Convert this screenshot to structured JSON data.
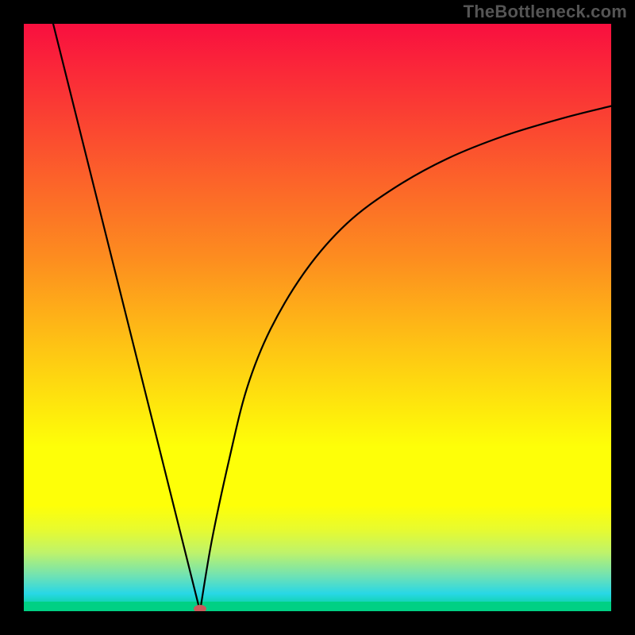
{
  "watermark": "TheBottleneck.com",
  "colors": {
    "frame": "#000000",
    "watermark": "#555555",
    "curve": "#000000",
    "marker": "#cc5a5a",
    "gradientStops": [
      {
        "offset": 0.0,
        "color": "#f90f3f"
      },
      {
        "offset": 0.2,
        "color": "#fb4e2f"
      },
      {
        "offset": 0.4,
        "color": "#fd8d1f"
      },
      {
        "offset": 0.55,
        "color": "#fec414"
      },
      {
        "offset": 0.72,
        "color": "#feff08"
      },
      {
        "offset": 0.82,
        "color": "#feff08"
      },
      {
        "offset": 0.86,
        "color": "#e8fb2e"
      },
      {
        "offset": 0.9,
        "color": "#bff36a"
      },
      {
        "offset": 0.94,
        "color": "#6fe2b4"
      },
      {
        "offset": 0.97,
        "color": "#28d7e6"
      },
      {
        "offset": 1.0,
        "color": "#00d084"
      }
    ],
    "finalGreen": "#00d084"
  },
  "chart_data": {
    "type": "line",
    "title": "",
    "xlabel": "",
    "ylabel": "",
    "xlim": [
      0,
      100
    ],
    "ylim": [
      0,
      100
    ],
    "grid": false,
    "x_min_at": 30,
    "marker": {
      "x": 30,
      "y": 0
    },
    "left_arm": {
      "x": [
        5,
        10,
        15,
        20,
        25,
        28,
        30
      ],
      "y": [
        100,
        80,
        60,
        40,
        20,
        8,
        0
      ]
    },
    "right_arm": {
      "x": [
        30,
        32,
        35,
        38,
        42,
        48,
        55,
        63,
        72,
        82,
        92,
        100
      ],
      "y": [
        0,
        12,
        26,
        38,
        48,
        58,
        66,
        72,
        77,
        81,
        84,
        86
      ]
    }
  }
}
